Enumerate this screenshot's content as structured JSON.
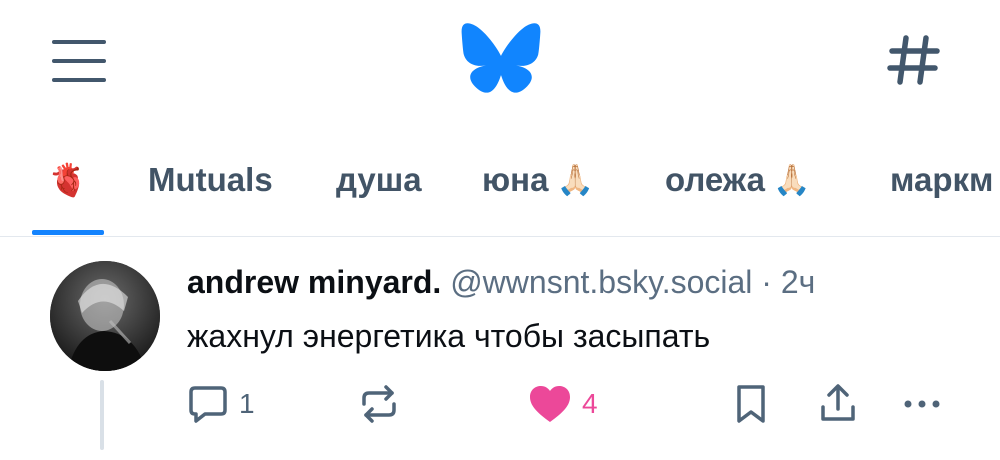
{
  "header": {
    "menu_icon": "hamburger-menu-icon",
    "logo_icon": "bluesky-butterfly-logo",
    "feeds_icon": "hashtag-icon",
    "accent_color": "#1383fe"
  },
  "tabs": [
    {
      "label": "",
      "emoji": "🫀",
      "active": true
    },
    {
      "label": "Mutuals",
      "emoji": ""
    },
    {
      "label": "душа",
      "emoji": ""
    },
    {
      "label": "юна",
      "emoji": "🙏🏻"
    },
    {
      "label": "олежа",
      "emoji": "🙏🏻"
    },
    {
      "label": "маркм",
      "emoji": ""
    }
  ],
  "post": {
    "display_name": "andrew minyard.",
    "handle": "@wwnsnt.bsky.social",
    "separator": "·",
    "time": "2ч",
    "text": "жахнул энергетика чтобы засыпать",
    "actions": {
      "reply_count": "1",
      "repost_count": "",
      "like_count": "4",
      "like_color": "#ec4899"
    }
  }
}
